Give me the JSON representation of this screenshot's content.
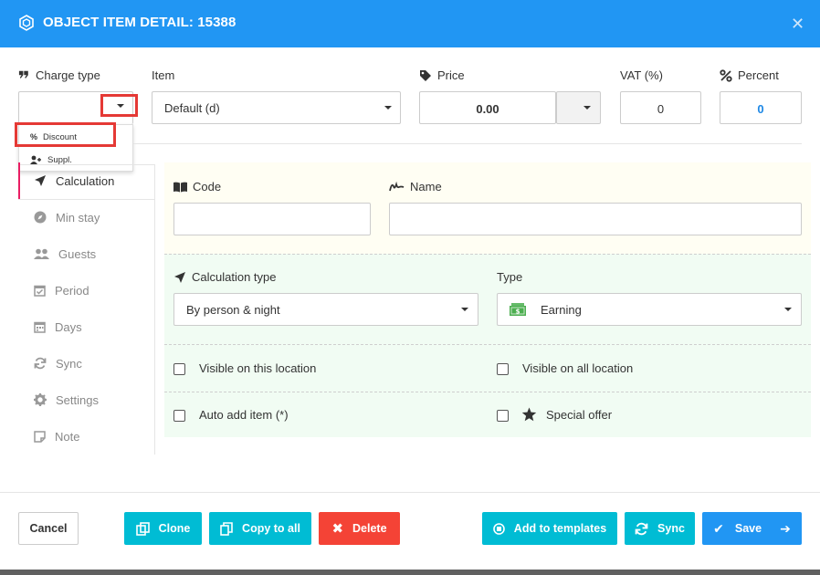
{
  "header": {
    "title": "OBJECT ITEM DETAIL: 15388",
    "close_icon": "close-icon"
  },
  "fields": {
    "charge_type": {
      "label": "Charge type",
      "value": ""
    },
    "item": {
      "label": "Item",
      "value": "Default (d)"
    },
    "price": {
      "label": "Price",
      "value": "0.00"
    },
    "vat": {
      "label": "VAT (%)",
      "value": "0"
    },
    "percent": {
      "label": "Percent",
      "value": "0"
    }
  },
  "charge_type_dropdown": {
    "options": [
      {
        "label": "Discount",
        "icon": "percent-icon"
      },
      {
        "label": "Suppl.",
        "icon": "user-plus-icon"
      }
    ]
  },
  "sidebar": {
    "items": [
      {
        "label": "Calculation",
        "icon": "location-arrow-icon",
        "active": true
      },
      {
        "label": "Min stay",
        "icon": "compass-icon"
      },
      {
        "label": "Guests",
        "icon": "users-icon"
      },
      {
        "label": "Period",
        "icon": "calendar-check-icon"
      },
      {
        "label": "Days",
        "icon": "calendar-icon"
      },
      {
        "label": "Sync",
        "icon": "sync-icon"
      },
      {
        "label": "Settings",
        "icon": "cog-icon"
      },
      {
        "label": "Note",
        "icon": "sticky-note-icon"
      }
    ]
  },
  "calculation": {
    "code": {
      "label": "Code",
      "value": ""
    },
    "name": {
      "label": "Name",
      "value": ""
    },
    "calc_type": {
      "label": "Calculation type",
      "value": "By person & night"
    },
    "type": {
      "label": "Type",
      "value": "Earning"
    },
    "visible_location": "Visible on this location",
    "visible_all": "Visible on all location",
    "auto_add": "Auto add item (*)",
    "special_offer": "Special offer"
  },
  "buttons": {
    "cancel": "Cancel",
    "clone": "Clone",
    "copy_to_all": "Copy to all",
    "delete": "Delete",
    "add_to_templates": "Add to templates",
    "sync": "Sync",
    "save": "Save"
  },
  "colors": {
    "header": "#2196f3",
    "cyan": "#00bcd4",
    "red": "#f44336",
    "active_border": "#e91e63",
    "highlight": "#e53935",
    "percent_value": "#1e88e5"
  }
}
